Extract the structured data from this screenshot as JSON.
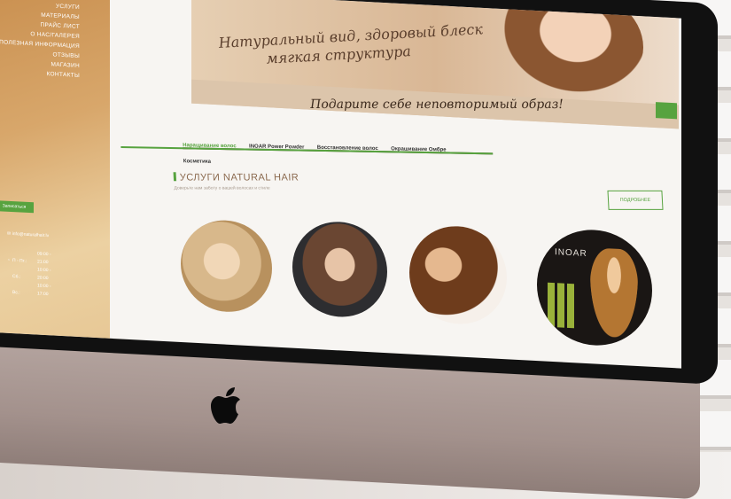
{
  "sidebar": {
    "menu": [
      "УСЛУГИ",
      "МАТЕРИАЛЫ",
      "ПРАЙС ЛИСТ",
      "О НАС/ГАЛЕРЕЯ",
      "ПОЛЕЗНАЯ ИНФОРМАЦИЯ",
      "ОТЗЫВЫ",
      "МАГАЗИН",
      "КОНТАКТЫ"
    ],
    "button": "Записаться",
    "email": "info@naturalhair.lv",
    "hours": [
      {
        "days": "П - Пт.:",
        "time": "09:00 - 21:00"
      },
      {
        "days": "Сб.:",
        "time": "10:00 - 20:00"
      },
      {
        "days": "Вс.:",
        "time": "10:00 - 17:00"
      }
    ]
  },
  "hero": {
    "line1": "Натуральный вид, здоровый блеск",
    "line2": "мягкая структура",
    "slogan": "Подарите себе неповторимый образ!"
  },
  "tabs": [
    "Наращивание волос",
    "INOAR Power Powder",
    "Восстановление волос",
    "Окрашивание Омбре",
    "Косметика"
  ],
  "services": {
    "title": "УСЛУГИ NATURAL HAIR",
    "subtitle": "Доверьте нам заботу о вашей волосах и стиле",
    "more": "ПОДРОБНЕЕ"
  },
  "circles": {
    "c4_logo": "INOAR"
  },
  "colors": {
    "accent_green": "#57a33f",
    "brown_text": "#5a3e2c"
  }
}
